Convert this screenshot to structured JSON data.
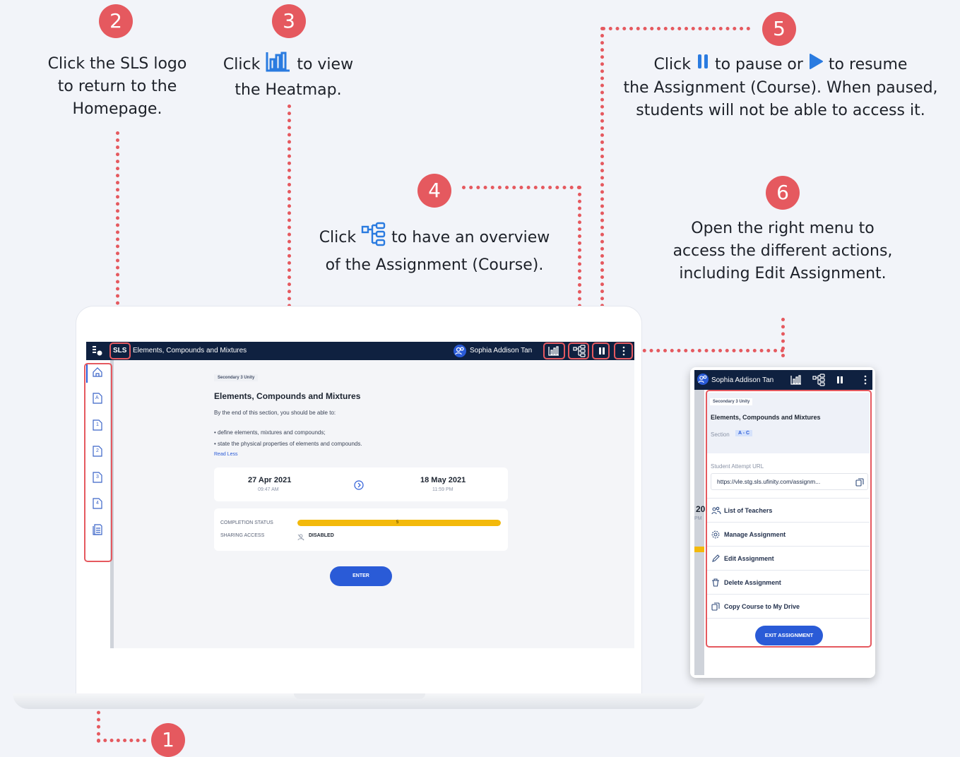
{
  "callouts": {
    "c1": {
      "number": "1"
    },
    "c2": {
      "number": "2",
      "text": "Click the SLS logo to return to the Homepage."
    },
    "c3": {
      "number": "3",
      "pre": "Click",
      "post": "to view",
      "line2": "the Heatmap."
    },
    "c4": {
      "number": "4",
      "pre": "Click",
      "post": "to have an overview",
      "line2": "of the Assignment (Course)."
    },
    "c5": {
      "number": "5",
      "pre": "Click",
      "mid": "to pause or",
      "post": "to resume",
      "line2": "the Assignment (Course). When paused,",
      "line3": "students will not be able to access it."
    },
    "c6": {
      "number": "6",
      "line1": "Open the right menu to",
      "line2": "access the different actions,",
      "line3": "including Edit Assignment."
    }
  },
  "app": {
    "logo": "SLS",
    "title": "Elements, Compounds and Mixtures",
    "user": "Sophia Addison Tan",
    "tag": "Secondary 3 Unity",
    "heading": "Elements, Compounds and Mixtures",
    "intro": "By the end of this section, you should be able to:",
    "bullets": [
      "define elements, mixtures and compounds;",
      "state the physical properties of elements and compounds."
    ],
    "read_less": "Read Less",
    "start_date": "27 Apr 2021",
    "start_time": "09:47 AM",
    "end_date": "18 May 2021",
    "end_time": "11:59 PM",
    "completion_label": "COMPLETION STATUS",
    "completion_value": "5",
    "completion_fraction": 1.0,
    "sharing_label": "SHARING ACCESS",
    "sharing_value": "DISABLED",
    "enter_button": "ENTER",
    "sidebar_labels": [
      "A",
      "1",
      "2",
      "3",
      "4"
    ]
  },
  "panel": {
    "user": "Sophia Addison Tan",
    "tag": "Secondary 3 Unity",
    "heading": "Elements, Compounds and Mixtures",
    "section_label": "Section",
    "section_value": "A - C",
    "url_label": "Student Attempt URL",
    "url_value": "https://vle.stg.sls.ufinity.com/assignm...",
    "peek_number": "20",
    "peek_suffix": "PM",
    "menu": [
      "List of Teachers",
      "Manage Assignment",
      "Edit Assignment",
      "Delete Assignment",
      "Copy Course to My Drive"
    ],
    "exit_button": "EXIT ASSIGNMENT"
  },
  "colors": {
    "accent": "#e5595f",
    "navy": "#0f2140",
    "primary": "#2a5bd7",
    "progress": "#f3b90b"
  }
}
